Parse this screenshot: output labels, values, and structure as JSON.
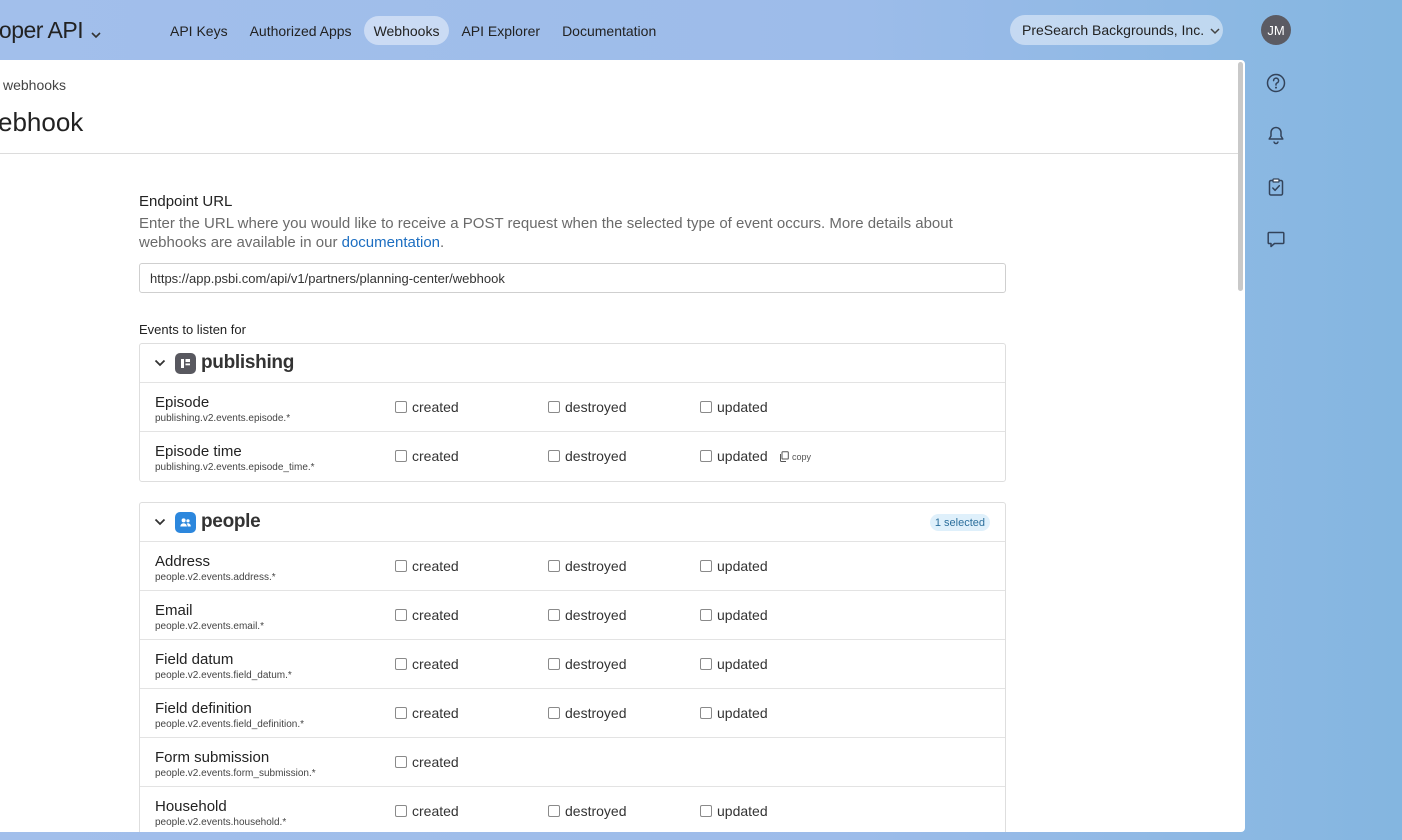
{
  "app": {
    "title": "eloper API"
  },
  "nav": [
    {
      "label": "API Keys",
      "active": false
    },
    {
      "label": "Authorized Apps",
      "active": false
    },
    {
      "label": "Webhooks",
      "active": true
    },
    {
      "label": "API Explorer",
      "active": false
    },
    {
      "label": "Documentation",
      "active": false
    }
  ],
  "org": {
    "name": "PreSearch Backgrounds, Inc."
  },
  "user": {
    "initials": "JM"
  },
  "rail": [
    "help-icon",
    "bell-icon",
    "clipboard-check-icon",
    "chat-icon"
  ],
  "breadcrumb": "webhooks",
  "page_title": "ebhook",
  "endpoint": {
    "label": "Endpoint URL",
    "help_before": "Enter the URL where you would like to receive a POST request when the selected type of event occurs. More details about webhooks are available in our ",
    "help_link": "documentation",
    "help_after": ".",
    "value": "https://app.psbi.com/api/v1/partners/planning-center/webhook"
  },
  "events_label": "Events to listen for",
  "options": {
    "created": "created",
    "destroyed": "destroyed",
    "updated": "updated",
    "copy": "copy"
  },
  "colors": {
    "publishing_icon": "#58585f",
    "people_icon": "#2c87dd",
    "link": "#1c6ec1"
  },
  "publishing": {
    "name": "publishing",
    "rows": [
      {
        "name": "Episode",
        "key": "publishing.v2.events.episode.*"
      },
      {
        "name": "Episode time",
        "key": "publishing.v2.events.episode_time.*"
      }
    ]
  },
  "people": {
    "name": "people",
    "badge": "1 selected",
    "rows": [
      {
        "name": "Address",
        "key": "people.v2.events.address.*"
      },
      {
        "name": "Email",
        "key": "people.v2.events.email.*"
      },
      {
        "name": "Field datum",
        "key": "people.v2.events.field_datum.*"
      },
      {
        "name": "Field definition",
        "key": "people.v2.events.field_definition.*"
      },
      {
        "name": "Form submission",
        "key": "people.v2.events.form_submission.*"
      },
      {
        "name": "Household",
        "key": "people.v2.events.household.*"
      }
    ]
  }
}
